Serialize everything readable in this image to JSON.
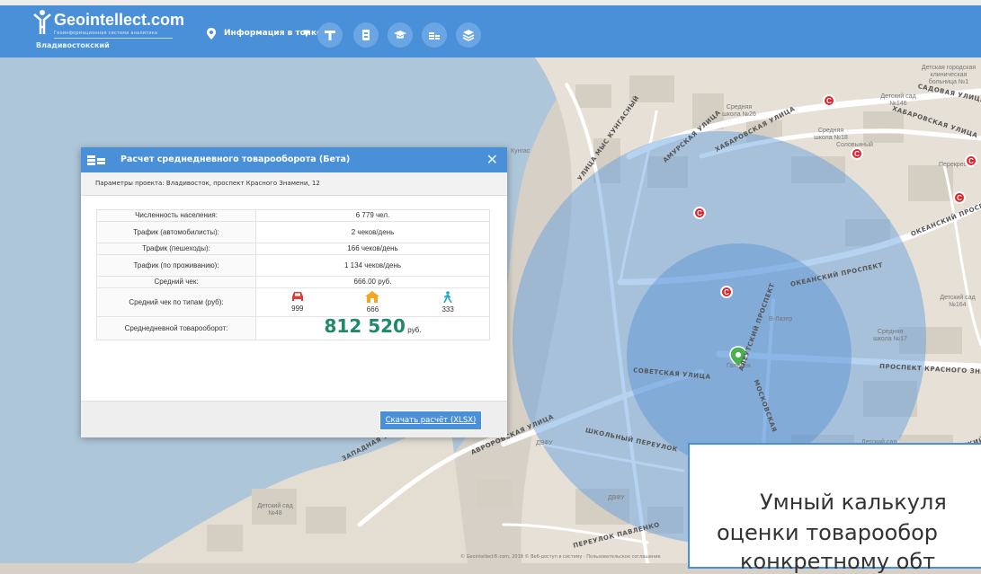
{
  "header": {
    "logo_name": "Geointellect",
    "logo_suffix": ".com",
    "logo_tagline": "Геоинформационная система аналитика",
    "region": "Владивостокский",
    "info_dropdown": "Информация в точке"
  },
  "map": {
    "streets": [
      "АМУРСКАЯ УЛИЦА",
      "ХАБАРОВСКАЯ УЛИЦА",
      "ХАБАРОВСКАЯ УЛИЦА",
      "УЛИЦА МЫС КУНГАСНЫЙ",
      "ОКЕАНСКИЙ ПРОСПЕКТ",
      "ОКЕАНСКИЙ ПРОСП.",
      "ПРОСПЕКТ КРАСНОГО ЗНА",
      "СОВЕТСКАЯ УЛИЦА",
      "АВРОРОВСКАЯ УЛИЦА",
      "ШКОЛЬНЫЙ ПЕРЕУЛОК",
      "ЗАПАДНАЯ УЛИЦА",
      "ПЕРЕУЛОК ПАВЛЕНКО",
      "МОСКОВСКАЯ",
      "САДОВАЯ УЛИЦА",
      "АЛЕУТСКИЙ ПРОСПЕКТ",
      "ОКЕАНСКИЙ ПРОСПЕКТ"
    ],
    "places": [
      "Детская городская клиническая больница №1",
      "Детский сад №146",
      "Средняя школа №26",
      "Средняя школа №18",
      "Кунгас",
      "Детский сад №164",
      "Средняя школа №17",
      "В-Лазер",
      "Галерея",
      "ДВФУ",
      "ДВФУ",
      "Детский сад №48",
      "Детский сад",
      "Перекресток",
      "Соловьиный"
    ],
    "poi_letter": "C",
    "footer": "© Geointellect®.com, 2018 © Веб-доступ в систему · Пользовательское соглашение"
  },
  "dialog": {
    "title": "Расчет среднедневного товарооборота (Бета)",
    "params": "Параметры проекта: Владивосток, проспект Красного Знамени, 12",
    "rows": [
      {
        "label": "Численность населения:",
        "value": "6 779 чел."
      },
      {
        "label": "Трафик (автомобилисты):",
        "value": "2 чеков/день"
      },
      {
        "label": "Трафик (пешеходы):",
        "value": "166 чеков/день"
      },
      {
        "label": "Трафик (по проживанию):",
        "value": "1 134 чеков/день"
      },
      {
        "label": "Средний чек:",
        "value": "666.00 руб."
      }
    ],
    "avg_by_type_label": "Средний чек по типам (руб):",
    "types": [
      {
        "icon": "car-icon",
        "value": "999"
      },
      {
        "icon": "house-icon",
        "value": "666"
      },
      {
        "icon": "pedestrian-icon",
        "value": "333"
      }
    ],
    "turnover_label": "Среднедневной товарооборот:",
    "turnover_value": "812 520",
    "turnover_unit": "руб.",
    "download": "Скачать расчёт (XLSX)"
  },
  "promo": {
    "line1": "Умный калькуля",
    "line2": "оценки товарообор",
    "line3": "конкретному обт"
  },
  "colors": {
    "header": "#4a90d9",
    "accent_green": "#1f8a6a",
    "poi_red": "#e0242c",
    "catchment_blue": "#5b9be0"
  }
}
